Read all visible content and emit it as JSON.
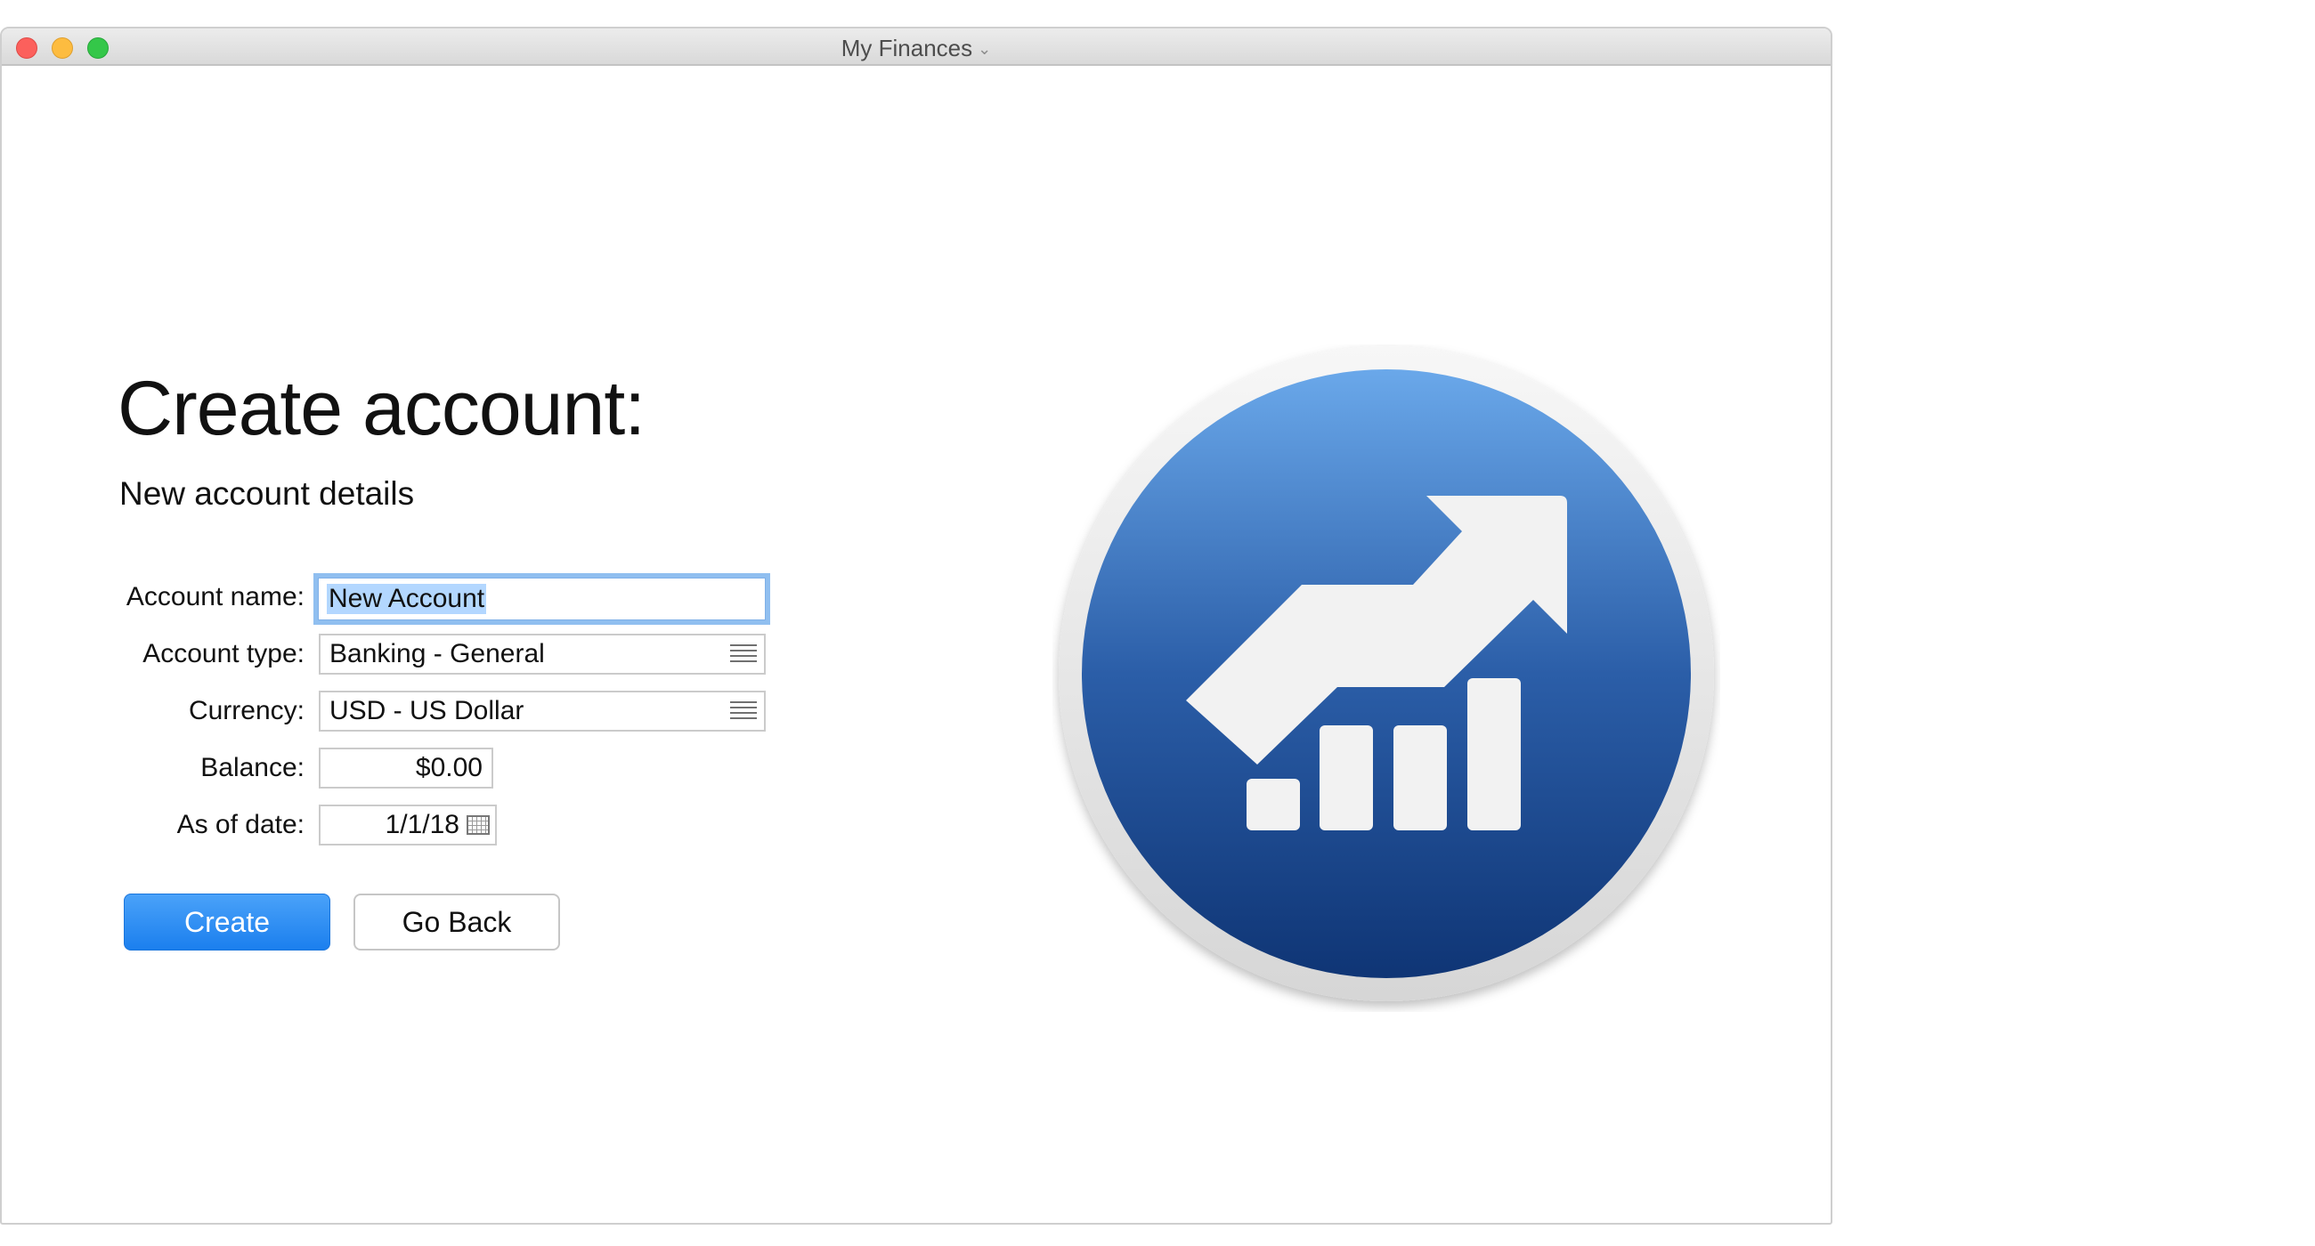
{
  "window": {
    "title": "My Finances",
    "title_chevron": "chevron-down-icon"
  },
  "main": {
    "heading": "Create account:",
    "subheading": "New account details"
  },
  "form": {
    "account_name": {
      "label": "Account name:",
      "value": "New Account"
    },
    "account_type": {
      "label": "Account type:",
      "value": "Banking - General"
    },
    "currency": {
      "label": "Currency:",
      "value": "USD - US Dollar"
    },
    "balance": {
      "label": "Balance:",
      "value": "$0.00"
    },
    "as_of_date": {
      "label": "As of date:",
      "value": "1/1/18"
    }
  },
  "buttons": {
    "create": "Create",
    "go_back": "Go Back"
  },
  "colors": {
    "accent_blue": "#2d8cf4",
    "logo_blue_top": "#6aa8ea",
    "logo_blue_bottom": "#0f3575",
    "selection_highlight": "#b3d7ff"
  },
  "logo": {
    "icon": "finance-growth-chart-icon"
  }
}
